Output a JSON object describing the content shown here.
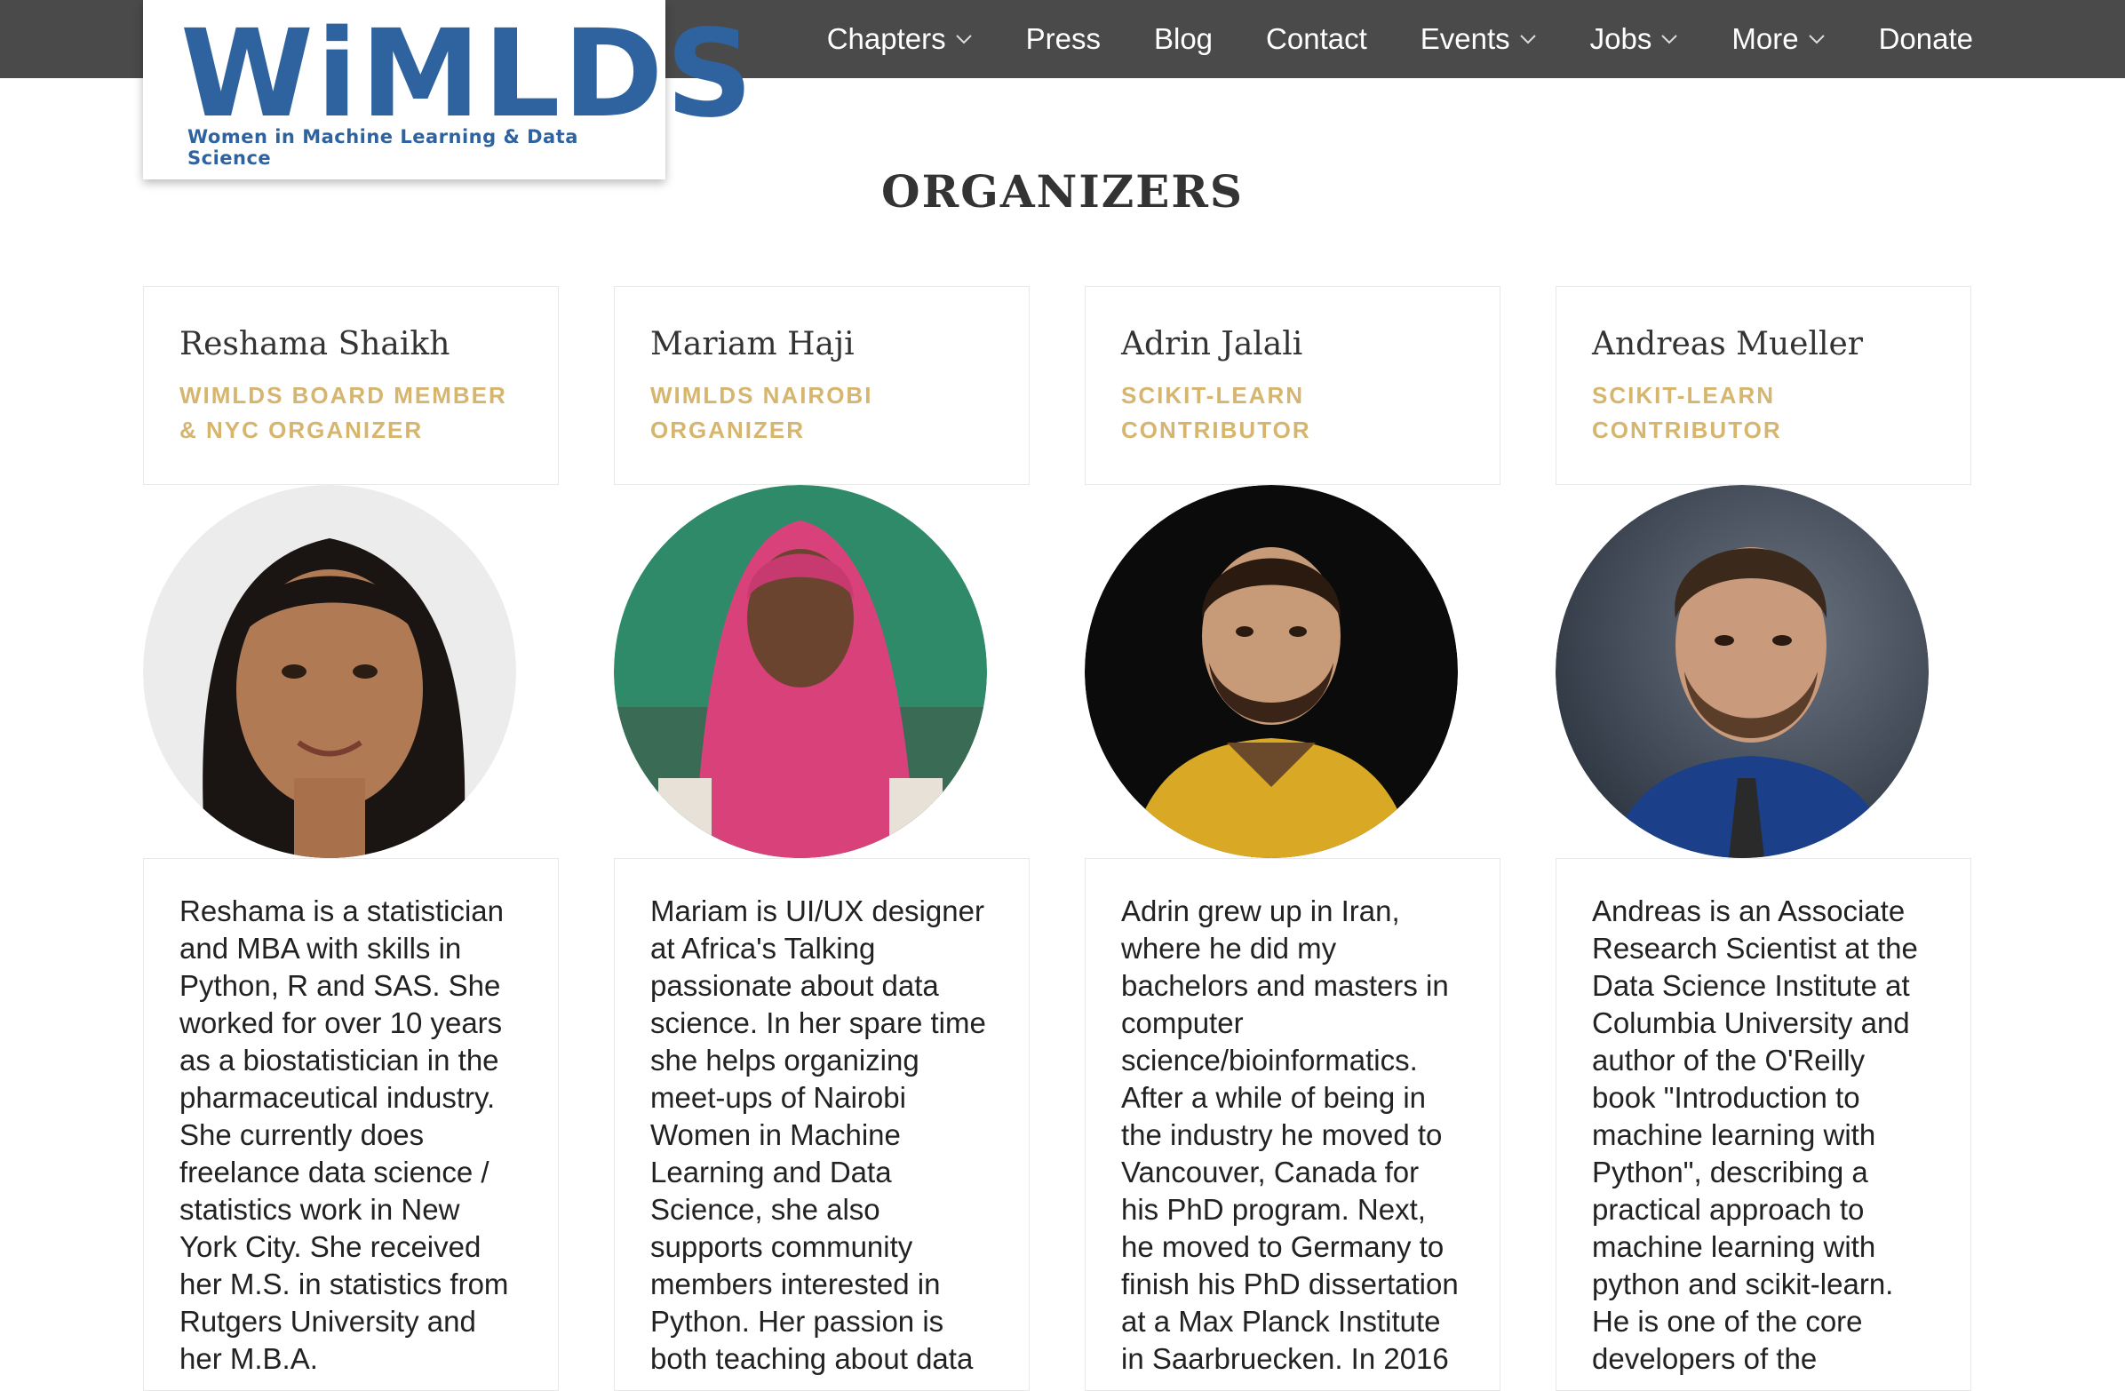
{
  "logo": {
    "word": "WiMLDS",
    "tagline": "Women in Machine Learning & Data Science"
  },
  "nav": {
    "items": [
      {
        "label": "Chapters",
        "dropdown": true
      },
      {
        "label": "Press",
        "dropdown": false
      },
      {
        "label": "Blog",
        "dropdown": false
      },
      {
        "label": "Contact",
        "dropdown": false
      },
      {
        "label": "Events",
        "dropdown": true
      },
      {
        "label": "Jobs",
        "dropdown": true
      },
      {
        "label": "More",
        "dropdown": true
      },
      {
        "label": "Donate",
        "dropdown": false
      }
    ]
  },
  "section": {
    "title": "ORGANIZERS"
  },
  "organizers": [
    {
      "name": "Reshama Shaikh",
      "role": "WiMLDS Board Member & NYC Organizer",
      "bio": "Reshama is a statistician and MBA with skills in Python, R and SAS. She worked for over 10 years as a biostatistician in the pharmaceutical industry. She currently does freelance data science / statistics work in New York City. She received her M.S. in statistics from Rutgers University and her M.B.A."
    },
    {
      "name": "Mariam Haji",
      "role": "WiMLDS Nairobi Organizer",
      "bio": "Mariam is UI/UX designer at Africa's Talking passionate about data science. In her spare time she helps organizing meet-ups of Nairobi Women in Machine Learning and Data Science, she also supports community members interested in Python. Her passion is both teaching about data"
    },
    {
      "name": "Adrin Jalali",
      "role": "scikit-learn contributor",
      "bio": "Adrin grew up in Iran, where he did my bachelors and masters in computer science/bioinformatics. After a while of being in the industry he moved to Vancouver, Canada for his PhD program. Next, he moved to Germany to finish his PhD dissertation at a Max Planck Institute in Saarbruecken. In 2016"
    },
    {
      "name": "Andreas Mueller",
      "role": "scikit-learn contributor",
      "bio": "Andreas is an Associate Research Scientist at the Data Science Institute at Columbia University and author of the O'Reilly book \"Introduction to machine learning with Python\", describing a practical approach to machine learning with python and scikit-learn. He is one of the core developers of the"
    }
  ],
  "colors": {
    "topbar": "#4a4a4a",
    "brand": "#2e63a0",
    "role_gold": "#d6b56f"
  }
}
